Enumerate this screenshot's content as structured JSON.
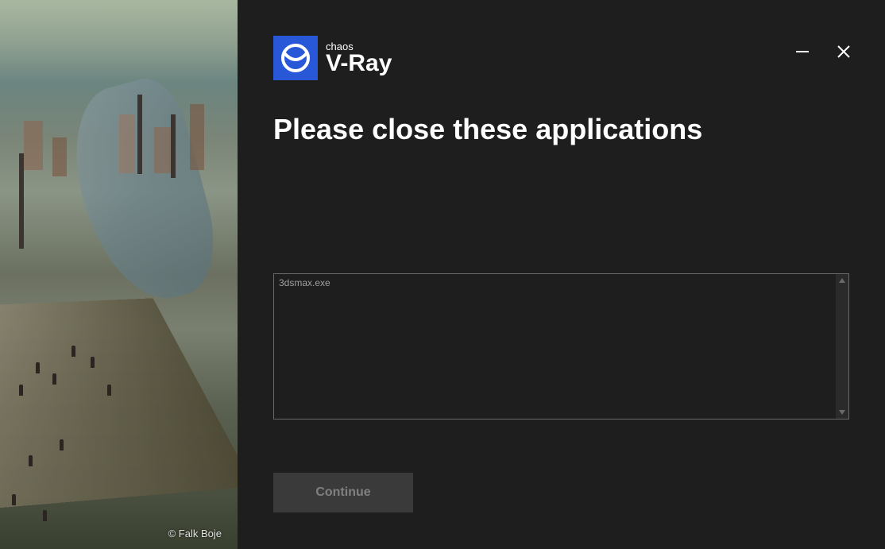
{
  "sidebar": {
    "credit": "© Falk Boje"
  },
  "header": {
    "logo": {
      "brand": "chaos",
      "product": "V-Ray"
    }
  },
  "content": {
    "title": "Please close these applications",
    "applications_text": "3dsmax.exe",
    "continue_label": "Continue"
  }
}
